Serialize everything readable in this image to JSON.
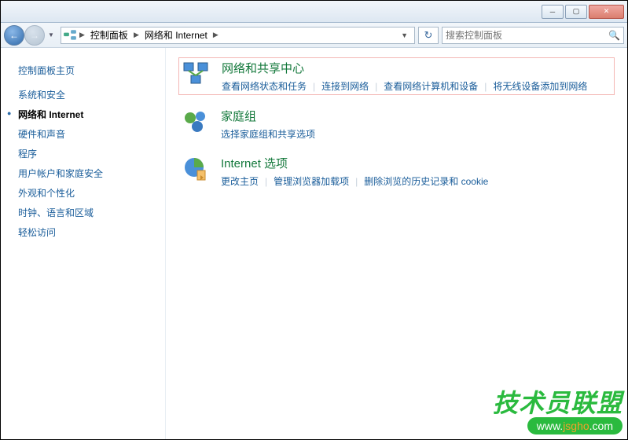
{
  "titlebar": {},
  "breadcrumb": {
    "seg1": "控制面板",
    "seg2": "网络和 Internet"
  },
  "search": {
    "placeholder": "搜索控制面板"
  },
  "sidebar": {
    "title": "控制面板主页",
    "items": [
      {
        "label": "系统和安全",
        "active": false
      },
      {
        "label": "网络和 Internet",
        "active": true
      },
      {
        "label": "硬件和声音",
        "active": false
      },
      {
        "label": "程序",
        "active": false
      },
      {
        "label": "用户帐户和家庭安全",
        "active": false
      },
      {
        "label": "外观和个性化",
        "active": false
      },
      {
        "label": "时钟、语言和区域",
        "active": false
      },
      {
        "label": "轻松访问",
        "active": false
      }
    ]
  },
  "categories": [
    {
      "title": "网络和共享中心",
      "highlighted": true,
      "links": [
        "查看网络状态和任务",
        "连接到网络",
        "查看网络计算机和设备",
        "将无线设备添加到网络"
      ]
    },
    {
      "title": "家庭组",
      "highlighted": false,
      "links": [
        "选择家庭组和共享选项"
      ]
    },
    {
      "title": "Internet 选项",
      "highlighted": false,
      "links": [
        "更改主页",
        "管理浏览器加载项",
        "删除浏览的历史记录和 cookie"
      ]
    }
  ],
  "watermark": {
    "text": "技术员联盟",
    "url_prefix": "www.",
    "url_main": "jsgho",
    "url_suffix": ".com"
  }
}
